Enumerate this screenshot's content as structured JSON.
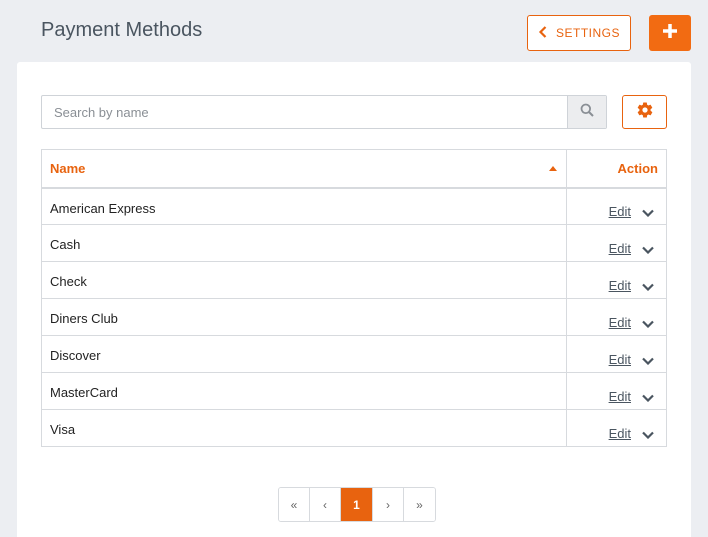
{
  "header": {
    "title": "Payment Methods",
    "settings_label": "SETTINGS",
    "settings_icon": "chevron-left-icon",
    "add_icon": "plus-icon"
  },
  "search": {
    "placeholder": "Search by name",
    "value": "",
    "search_icon": "search-icon",
    "gear_icon": "gear-icon"
  },
  "table": {
    "columns": {
      "name": "Name",
      "action": "Action"
    },
    "sort": "ascending",
    "rows": [
      {
        "name": "American Express",
        "edit": "Edit"
      },
      {
        "name": "Cash",
        "edit": "Edit"
      },
      {
        "name": "Check",
        "edit": "Edit"
      },
      {
        "name": "Diners Club",
        "edit": "Edit"
      },
      {
        "name": "Discover",
        "edit": "Edit"
      },
      {
        "name": "MasterCard",
        "edit": "Edit"
      },
      {
        "name": "Visa",
        "edit": "Edit"
      }
    ]
  },
  "pagination": {
    "first": "«",
    "prev": "‹",
    "current": "1",
    "next": "›",
    "last": "»"
  },
  "colors": {
    "accent": "#e8630f",
    "background": "#eceef2",
    "text": "#4a5560"
  }
}
